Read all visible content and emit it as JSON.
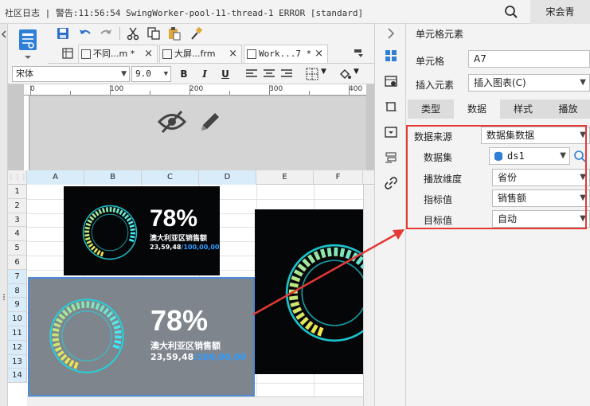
{
  "topbar": {
    "log": "社区日志 | 警告:11:56:54 SwingWorker-pool-11-thread-1 ERROR [standard]",
    "user": "宋会青"
  },
  "tabs": [
    {
      "label": "不同...m *",
      "close": "×"
    },
    {
      "label": "大屏...frm",
      "close": "×"
    },
    {
      "label": "Work...7 *",
      "close": "×"
    }
  ],
  "fontbar": {
    "font": "宋体",
    "size": "9.0",
    "bold": "B",
    "italic": "I",
    "underline": "U"
  },
  "ruler": {
    "marks": [
      "0",
      "100",
      "200",
      "300",
      "400"
    ]
  },
  "grid": {
    "columns": [
      "A",
      "B",
      "C",
      "D",
      "E",
      "F"
    ],
    "rows": [
      "1",
      "2",
      "3",
      "4",
      "5",
      "6",
      "7",
      "8",
      "9",
      "10",
      "11",
      "12",
      "13",
      "14"
    ]
  },
  "widget": {
    "percent": "78%",
    "title": "澳大利亚区销售额",
    "value_a": "23,59,48",
    "value_b": "/100,00,00",
    "progress": 0.78,
    "colors": {
      "ring": "#1fd6e0",
      "accent_start": "#f2e64b",
      "accent_end": "#3be5ff",
      "bg": "#050608"
    }
  },
  "panel": {
    "title": "单元格元素",
    "cell_label": "单元格",
    "cell_value": "A7",
    "insert_label": "插入元素",
    "insert_value": "插入图表(C)",
    "tabs": [
      "类型",
      "数据",
      "样式",
      "播放"
    ],
    "active_tab": "数据",
    "fields": [
      {
        "label": "数据来源",
        "value": "数据集数据"
      },
      {
        "label": "数据集",
        "value": "ds1"
      },
      {
        "label": "播放维度",
        "value": "省份"
      },
      {
        "label": "指标值",
        "value": "销售额"
      },
      {
        "label": "目标值",
        "value": "自动"
      }
    ],
    "highlight_color": "#e53935"
  }
}
